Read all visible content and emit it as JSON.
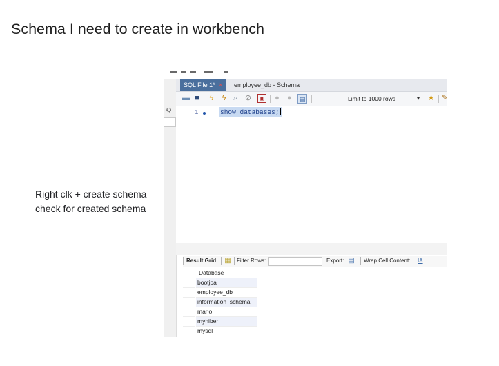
{
  "slide": {
    "title": "Schema I need to create in workbench",
    "notes": [
      "Right clk + create schema",
      "check for created schema"
    ]
  },
  "workbench": {
    "tabs": [
      {
        "label": "SQL File 1*",
        "active": true,
        "close": "×"
      },
      {
        "label": "employee_db - Schema",
        "active": false
      }
    ],
    "toolbar": {
      "icons": [
        "folder-icon",
        "save-icon",
        "execute-icon",
        "execute-current-icon",
        "explain-icon",
        "stop-icon",
        "toggle-icon",
        "commit-icon",
        "rollback-icon",
        "autocommit-icon",
        "beautify-icon",
        "clear-icon"
      ],
      "limit_label": "Limit to 1000 rows",
      "limit_caret": "▾"
    },
    "editor": {
      "line_number": "1",
      "code": "show databases;"
    },
    "result_bar": {
      "result_grid_label": "Result Grid",
      "filter_rows_label": "Filter Rows:",
      "export_label": "Export:",
      "wrap_label": "Wrap Cell Content:",
      "wrap_icon": "IA"
    },
    "grid": {
      "header": "Database",
      "rows": [
        "bootjpa",
        "employee_db",
        "information_schema",
        "mario",
        "myhiber",
        "mysql"
      ]
    }
  },
  "colors": {
    "active_tab": "#4a6f9d",
    "selection": "#c8daf2",
    "code_text": "#1c3e8a"
  }
}
